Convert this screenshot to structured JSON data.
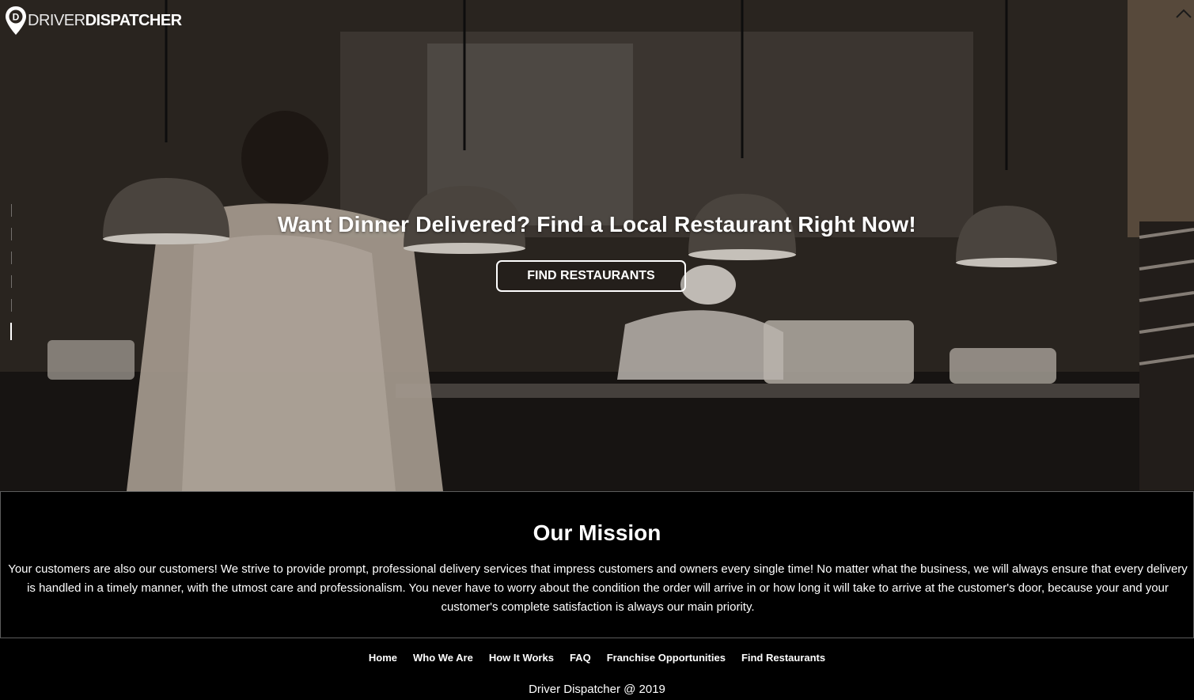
{
  "logo": {
    "text_light": "DRIVER",
    "text_bold": "DISPATCHER",
    "pin_letter": "D"
  },
  "hero": {
    "headline": "Want Dinner Delivered? Find a Local Restaurant Right Now!",
    "button_label": "FIND RESTAURANTS"
  },
  "mission": {
    "title": "Our Mission",
    "text": "Your customers are also our customers! We strive to provide prompt, professional delivery services that impress customers and owners every single time! No matter what the business, we will always ensure that every delivery is handled in a timely manner, with the utmost care and professionalism. You never have to worry about the condition the order will arrive in or how long it will take to arrive at the customer's door, because your and your customer's complete satisfaction is always our main priority."
  },
  "footer": {
    "nav": [
      {
        "label": "Home"
      },
      {
        "label": "Who We Are"
      },
      {
        "label": "How It Works"
      },
      {
        "label": "FAQ"
      },
      {
        "label": "Franchise Opportunities"
      },
      {
        "label": "Find Restaurants"
      }
    ],
    "copyright": "Driver Dispatcher @ 2019"
  },
  "icons": {
    "scroll_top": "chevron-up-icon",
    "logo_pin": "map-pin-icon"
  },
  "colors": {
    "background": "#000000",
    "text": "#ffffff",
    "divider": "#5c5c5c"
  }
}
